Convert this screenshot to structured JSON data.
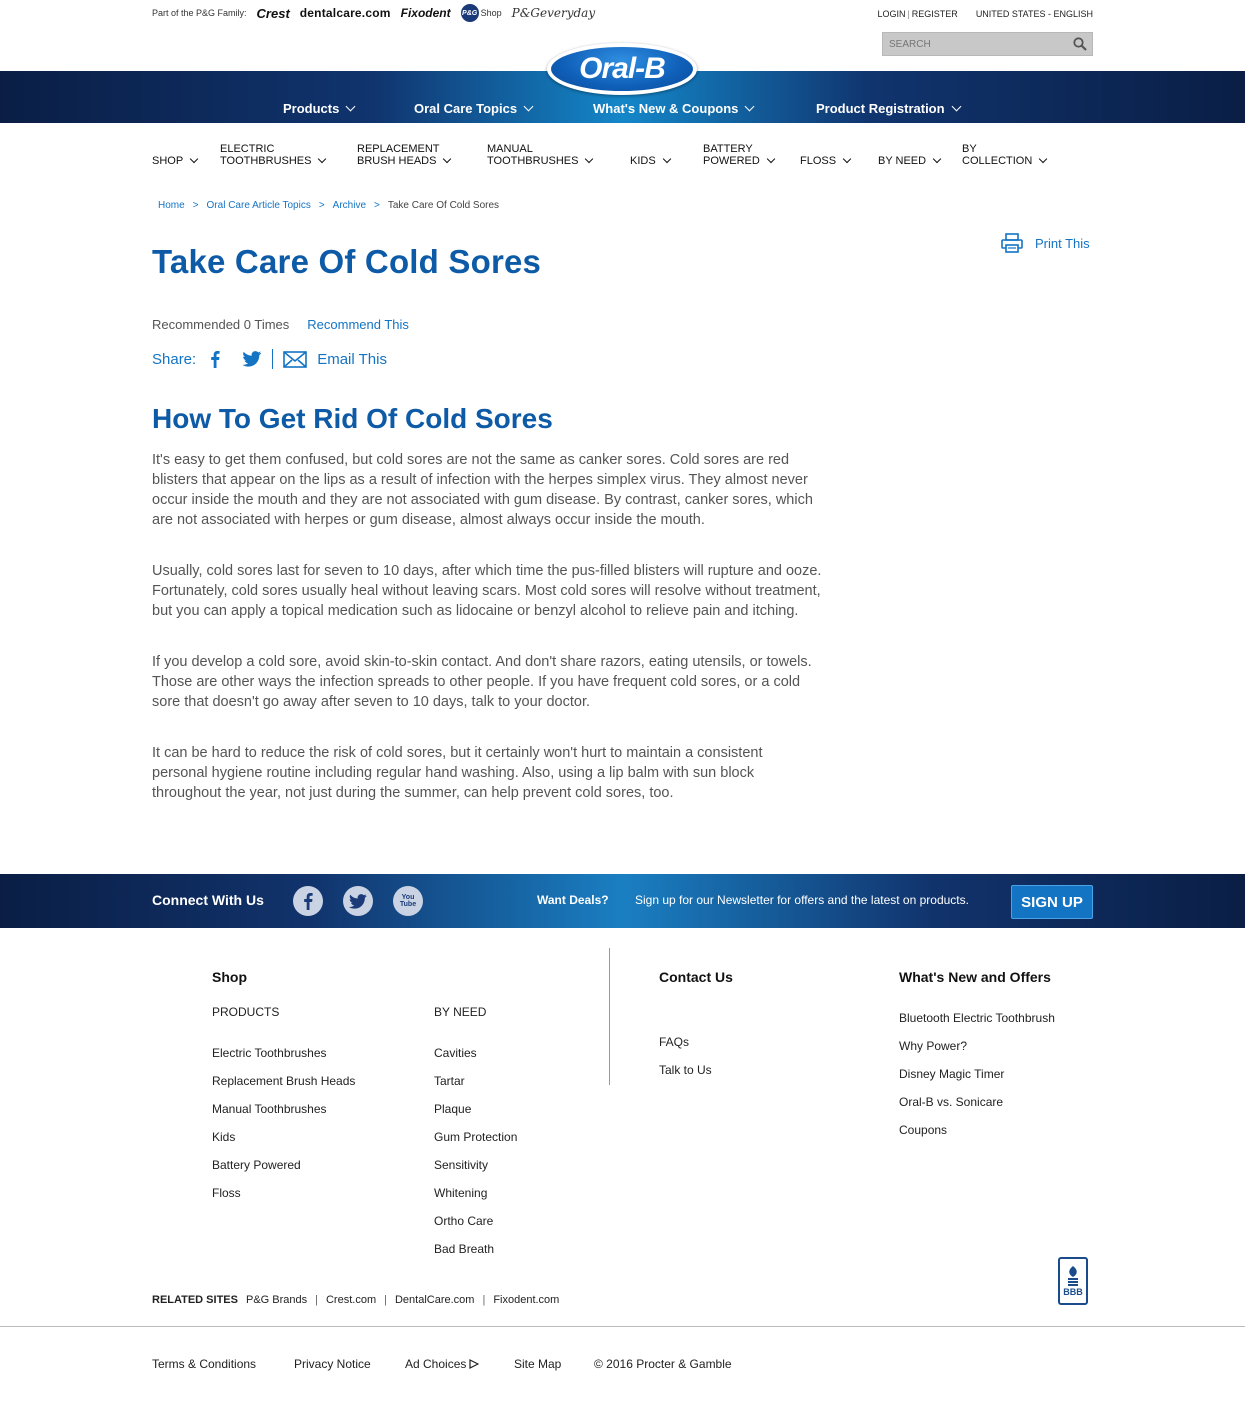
{
  "family": {
    "label": "Part of the P&G Family:",
    "brands": [
      "Crest",
      "dentalcare.com",
      "Fixodent",
      "Shop",
      "P&Geveryday"
    ]
  },
  "util": {
    "login": "LOGIN",
    "register": "REGISTER",
    "region": "UNITED STATES - ENGLISH"
  },
  "search": {
    "placeholder": "SEARCH"
  },
  "logo": {
    "text": "Oral-B"
  },
  "mainnav": [
    "Products",
    "Oral Care Topics",
    "What's New & Coupons",
    "Product Registration"
  ],
  "subnav": [
    {
      "line1": "",
      "line2": "SHOP"
    },
    {
      "line1": "ELECTRIC",
      "line2": "TOOTHBRUSHES"
    },
    {
      "line1": "REPLACEMENT",
      "line2": "BRUSH HEADS"
    },
    {
      "line1": "MANUAL",
      "line2": "TOOTHBRUSHES"
    },
    {
      "line1": "",
      "line2": "KIDS"
    },
    {
      "line1": "BATTERY",
      "line2": "POWERED"
    },
    {
      "line1": "",
      "line2": "FLOSS"
    },
    {
      "line1": "",
      "line2": "BY NEED"
    },
    {
      "line1": "BY",
      "line2": "COLLECTION"
    }
  ],
  "breadcrumb": [
    "Home",
    "Oral Care Article Topics",
    "Archive",
    "Take Care Of Cold Sores"
  ],
  "print": "Print This",
  "title": "Take Care Of Cold Sores",
  "recommend": {
    "count": "Recommended 0 Times",
    "link": "Recommend This"
  },
  "share": {
    "label": "Share:",
    "email": "Email This"
  },
  "subtitle": "How To Get Rid Of Cold Sores",
  "article": [
    "It's easy to get them confused, but cold sores are not the same as canker sores. Cold sores are red blisters that appear on the lips as a result of infection with the herpes simplex virus. They almost never occur inside the mouth and they are not associated with gum disease. By contrast, canker sores, which are not associated with herpes or gum disease, almost always occur inside the mouth.",
    "Usually, cold sores last for seven to 10 days, after which time the pus-filled blisters will rupture and ooze. Fortunately, cold sores usually heal without leaving scars. Most cold sores will resolve without treatment, but you can apply a topical medication such as lidocaine or benzyl alcohol to relieve pain and itching.",
    "If you develop a cold sore, avoid skin-to-skin contact. And don't share razors, eating utensils, or towels. Those are other ways the infection spreads to other people. If you have frequent cold sores, or a cold sore that doesn't go away after seven to 10 days, talk to your doctor.",
    "It can be hard to reduce the risk of cold sores, but it certainly won't hurt to maintain a consistent personal hygiene routine including regular hand washing. Also, using a lip balm with sun block throughout the year, not just during the summer, can help prevent cold sores, too."
  ],
  "connect": {
    "label": "Connect With Us",
    "youtube": "You Tube",
    "deals": "Want Deals?",
    "newsletter": "Sign up for our Newsletter for offers and the latest on products.",
    "signup": "SIGN UP"
  },
  "footer": {
    "shop_heading": "Shop",
    "products_heading": "PRODUCTS",
    "products": [
      "Electric Toothbrushes",
      "Replacement Brush Heads",
      "Manual Toothbrushes",
      "Kids",
      "Battery Powered",
      "Floss"
    ],
    "byneed_heading": "BY NEED",
    "byneed": [
      "Cavities",
      "Tartar",
      "Plaque",
      "Gum Protection",
      "Sensitivity",
      "Whitening",
      "Ortho Care",
      "Bad Breath"
    ],
    "contact_heading": "Contact Us",
    "contact": [
      "FAQs",
      "Talk to Us"
    ],
    "whatsnew_heading": "What's New and Offers",
    "whatsnew": [
      "Bluetooth Electric Toothbrush",
      "Why Power?",
      "Disney Magic Timer",
      "Oral-B vs. Sonicare",
      "Coupons"
    ]
  },
  "related": {
    "label": "RELATED SITES",
    "sites": [
      "P&G Brands",
      "Crest.com",
      "DentalCare.com",
      "Fixodent.com"
    ]
  },
  "bbb": "BBB",
  "legal": [
    "Terms & Conditions",
    "Privacy Notice",
    "Ad Choices",
    "Site Map",
    "© 2016 Procter & Gamble"
  ],
  "colors": {
    "navy": "#0a1e45",
    "brand_blue": "#0d5aa6",
    "link_blue": "#1474c4"
  }
}
